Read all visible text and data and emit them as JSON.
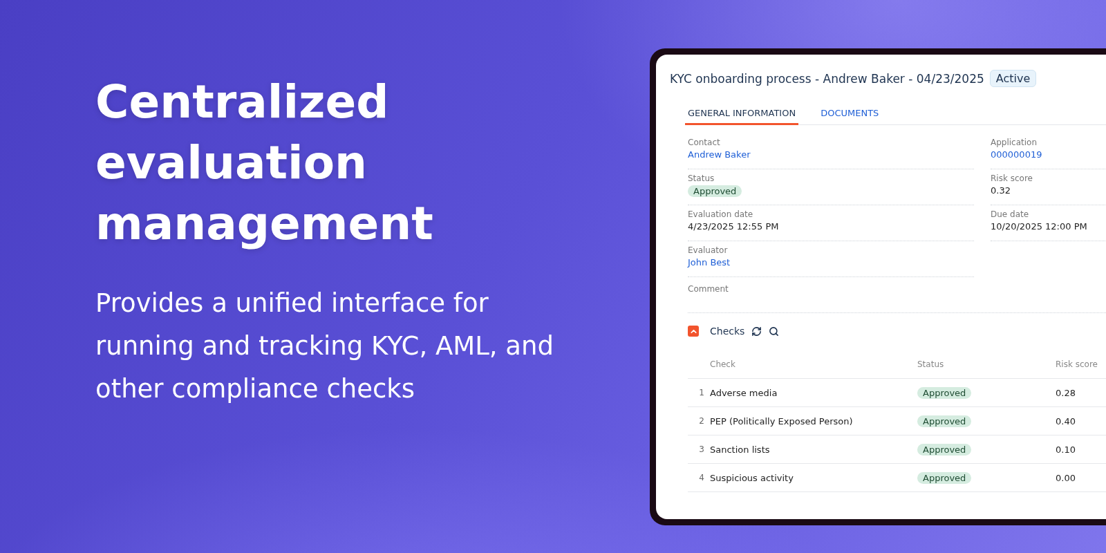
{
  "headline": "Centralized evaluation management",
  "description": "Provides a unified interface for running and tracking KYC, AML, and other compliance checks",
  "app": {
    "title": "KYC onboarding process - Andrew Baker - 04/23/2025",
    "badge": "Active",
    "tabs": [
      {
        "label": "GENERAL INFORMATION",
        "selected": true
      },
      {
        "label": "DOCUMENTS",
        "selected": false
      }
    ],
    "fields_left": [
      {
        "label": "Contact",
        "value": "Andrew Baker",
        "kind": "link"
      },
      {
        "label": "Status",
        "value": "Approved",
        "kind": "pill"
      },
      {
        "label": "Evaluation date",
        "value": "4/23/2025 12:55 PM",
        "kind": "text"
      },
      {
        "label": "Evaluator",
        "value": "John Best",
        "kind": "link"
      }
    ],
    "fields_right": [
      {
        "label": "Application",
        "value": "000000019",
        "kind": "link"
      },
      {
        "label": "Risk score",
        "value": "0.32",
        "kind": "text"
      },
      {
        "label": "Due date",
        "value": "10/20/2025 12:00 PM",
        "kind": "text"
      }
    ],
    "comment_label": "Comment",
    "checks": {
      "title": "Checks",
      "expanded": true,
      "columns": [
        "Check",
        "Status",
        "Risk score"
      ],
      "rows": [
        {
          "number": "1",
          "check": "Adverse media",
          "status": "Approved",
          "risk_score": "0.28"
        },
        {
          "number": "2",
          "check": "PEP (Politically Exposed Person)",
          "status": "Approved",
          "risk_score": "0.40"
        },
        {
          "number": "3",
          "check": "Sanction lists",
          "status": "Approved",
          "risk_score": "0.10"
        },
        {
          "number": "4",
          "check": "Suspicious activity",
          "status": "Approved",
          "risk_score": "0.00"
        }
      ]
    }
  }
}
